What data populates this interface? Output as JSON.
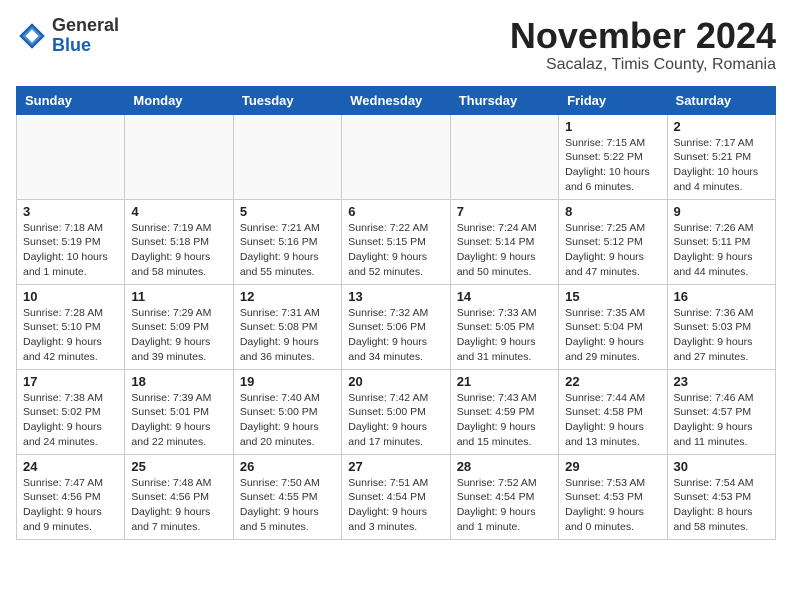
{
  "header": {
    "logo_line1": "General",
    "logo_line2": "Blue",
    "month_title": "November 2024",
    "location": "Sacalaz, Timis County, Romania"
  },
  "weekdays": [
    "Sunday",
    "Monday",
    "Tuesday",
    "Wednesday",
    "Thursday",
    "Friday",
    "Saturday"
  ],
  "weeks": [
    [
      {
        "day": "",
        "info": ""
      },
      {
        "day": "",
        "info": ""
      },
      {
        "day": "",
        "info": ""
      },
      {
        "day": "",
        "info": ""
      },
      {
        "day": "",
        "info": ""
      },
      {
        "day": "1",
        "info": "Sunrise: 7:15 AM\nSunset: 5:22 PM\nDaylight: 10 hours\nand 6 minutes."
      },
      {
        "day": "2",
        "info": "Sunrise: 7:17 AM\nSunset: 5:21 PM\nDaylight: 10 hours\nand 4 minutes."
      }
    ],
    [
      {
        "day": "3",
        "info": "Sunrise: 7:18 AM\nSunset: 5:19 PM\nDaylight: 10 hours\nand 1 minute."
      },
      {
        "day": "4",
        "info": "Sunrise: 7:19 AM\nSunset: 5:18 PM\nDaylight: 9 hours\nand 58 minutes."
      },
      {
        "day": "5",
        "info": "Sunrise: 7:21 AM\nSunset: 5:16 PM\nDaylight: 9 hours\nand 55 minutes."
      },
      {
        "day": "6",
        "info": "Sunrise: 7:22 AM\nSunset: 5:15 PM\nDaylight: 9 hours\nand 52 minutes."
      },
      {
        "day": "7",
        "info": "Sunrise: 7:24 AM\nSunset: 5:14 PM\nDaylight: 9 hours\nand 50 minutes."
      },
      {
        "day": "8",
        "info": "Sunrise: 7:25 AM\nSunset: 5:12 PM\nDaylight: 9 hours\nand 47 minutes."
      },
      {
        "day": "9",
        "info": "Sunrise: 7:26 AM\nSunset: 5:11 PM\nDaylight: 9 hours\nand 44 minutes."
      }
    ],
    [
      {
        "day": "10",
        "info": "Sunrise: 7:28 AM\nSunset: 5:10 PM\nDaylight: 9 hours\nand 42 minutes."
      },
      {
        "day": "11",
        "info": "Sunrise: 7:29 AM\nSunset: 5:09 PM\nDaylight: 9 hours\nand 39 minutes."
      },
      {
        "day": "12",
        "info": "Sunrise: 7:31 AM\nSunset: 5:08 PM\nDaylight: 9 hours\nand 36 minutes."
      },
      {
        "day": "13",
        "info": "Sunrise: 7:32 AM\nSunset: 5:06 PM\nDaylight: 9 hours\nand 34 minutes."
      },
      {
        "day": "14",
        "info": "Sunrise: 7:33 AM\nSunset: 5:05 PM\nDaylight: 9 hours\nand 31 minutes."
      },
      {
        "day": "15",
        "info": "Sunrise: 7:35 AM\nSunset: 5:04 PM\nDaylight: 9 hours\nand 29 minutes."
      },
      {
        "day": "16",
        "info": "Sunrise: 7:36 AM\nSunset: 5:03 PM\nDaylight: 9 hours\nand 27 minutes."
      }
    ],
    [
      {
        "day": "17",
        "info": "Sunrise: 7:38 AM\nSunset: 5:02 PM\nDaylight: 9 hours\nand 24 minutes."
      },
      {
        "day": "18",
        "info": "Sunrise: 7:39 AM\nSunset: 5:01 PM\nDaylight: 9 hours\nand 22 minutes."
      },
      {
        "day": "19",
        "info": "Sunrise: 7:40 AM\nSunset: 5:00 PM\nDaylight: 9 hours\nand 20 minutes."
      },
      {
        "day": "20",
        "info": "Sunrise: 7:42 AM\nSunset: 5:00 PM\nDaylight: 9 hours\nand 17 minutes."
      },
      {
        "day": "21",
        "info": "Sunrise: 7:43 AM\nSunset: 4:59 PM\nDaylight: 9 hours\nand 15 minutes."
      },
      {
        "day": "22",
        "info": "Sunrise: 7:44 AM\nSunset: 4:58 PM\nDaylight: 9 hours\nand 13 minutes."
      },
      {
        "day": "23",
        "info": "Sunrise: 7:46 AM\nSunset: 4:57 PM\nDaylight: 9 hours\nand 11 minutes."
      }
    ],
    [
      {
        "day": "24",
        "info": "Sunrise: 7:47 AM\nSunset: 4:56 PM\nDaylight: 9 hours\nand 9 minutes."
      },
      {
        "day": "25",
        "info": "Sunrise: 7:48 AM\nSunset: 4:56 PM\nDaylight: 9 hours\nand 7 minutes."
      },
      {
        "day": "26",
        "info": "Sunrise: 7:50 AM\nSunset: 4:55 PM\nDaylight: 9 hours\nand 5 minutes."
      },
      {
        "day": "27",
        "info": "Sunrise: 7:51 AM\nSunset: 4:54 PM\nDaylight: 9 hours\nand 3 minutes."
      },
      {
        "day": "28",
        "info": "Sunrise: 7:52 AM\nSunset: 4:54 PM\nDaylight: 9 hours\nand 1 minute."
      },
      {
        "day": "29",
        "info": "Sunrise: 7:53 AM\nSunset: 4:53 PM\nDaylight: 9 hours\nand 0 minutes."
      },
      {
        "day": "30",
        "info": "Sunrise: 7:54 AM\nSunset: 4:53 PM\nDaylight: 8 hours\nand 58 minutes."
      }
    ]
  ]
}
